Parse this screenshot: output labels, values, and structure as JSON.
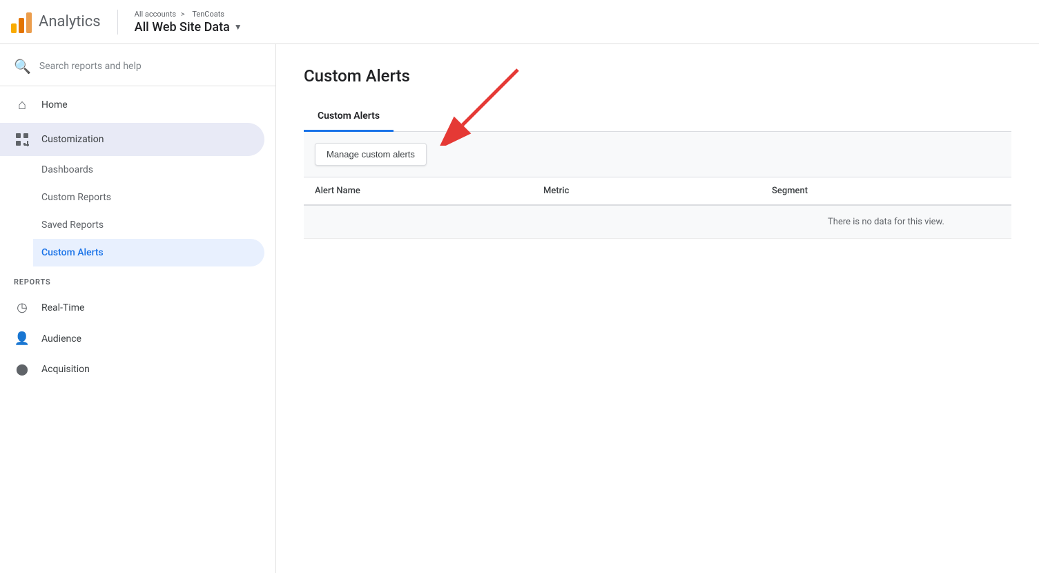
{
  "header": {
    "logo_alt": "Google Analytics",
    "title": "Analytics",
    "breadcrumb_link": "All accounts",
    "breadcrumb_separator": ">",
    "breadcrumb_account": "TenCoats",
    "property_name": "All Web Site Data"
  },
  "sidebar": {
    "search_placeholder": "Search reports and help",
    "nav_items": [
      {
        "id": "home",
        "label": "Home",
        "icon": "home"
      },
      {
        "id": "customization",
        "label": "Customization",
        "icon": "grid",
        "active": true
      }
    ],
    "customization_sub_items": [
      {
        "id": "dashboards",
        "label": "Dashboards"
      },
      {
        "id": "custom-reports",
        "label": "Custom Reports"
      },
      {
        "id": "saved-reports",
        "label": "Saved Reports"
      },
      {
        "id": "custom-alerts",
        "label": "Custom Alerts",
        "active": true
      }
    ],
    "reports_section_label": "REPORTS",
    "reports_items": [
      {
        "id": "real-time",
        "label": "Real-Time",
        "icon": "clock"
      },
      {
        "id": "audience",
        "label": "Audience",
        "icon": "person"
      },
      {
        "id": "acquisition",
        "label": "Acquisition",
        "icon": "acquisition"
      }
    ]
  },
  "main": {
    "page_title": "Custom Alerts",
    "tabs": [
      {
        "id": "custom-alerts-tab",
        "label": "Custom Alerts",
        "active": true
      }
    ],
    "toolbar": {
      "manage_button_label": "Manage custom alerts"
    },
    "table": {
      "columns": [
        "Alert Name",
        "Metric",
        "Segment"
      ],
      "empty_message": "There is no data for this view."
    }
  },
  "arrow": {
    "color": "#e53935"
  }
}
